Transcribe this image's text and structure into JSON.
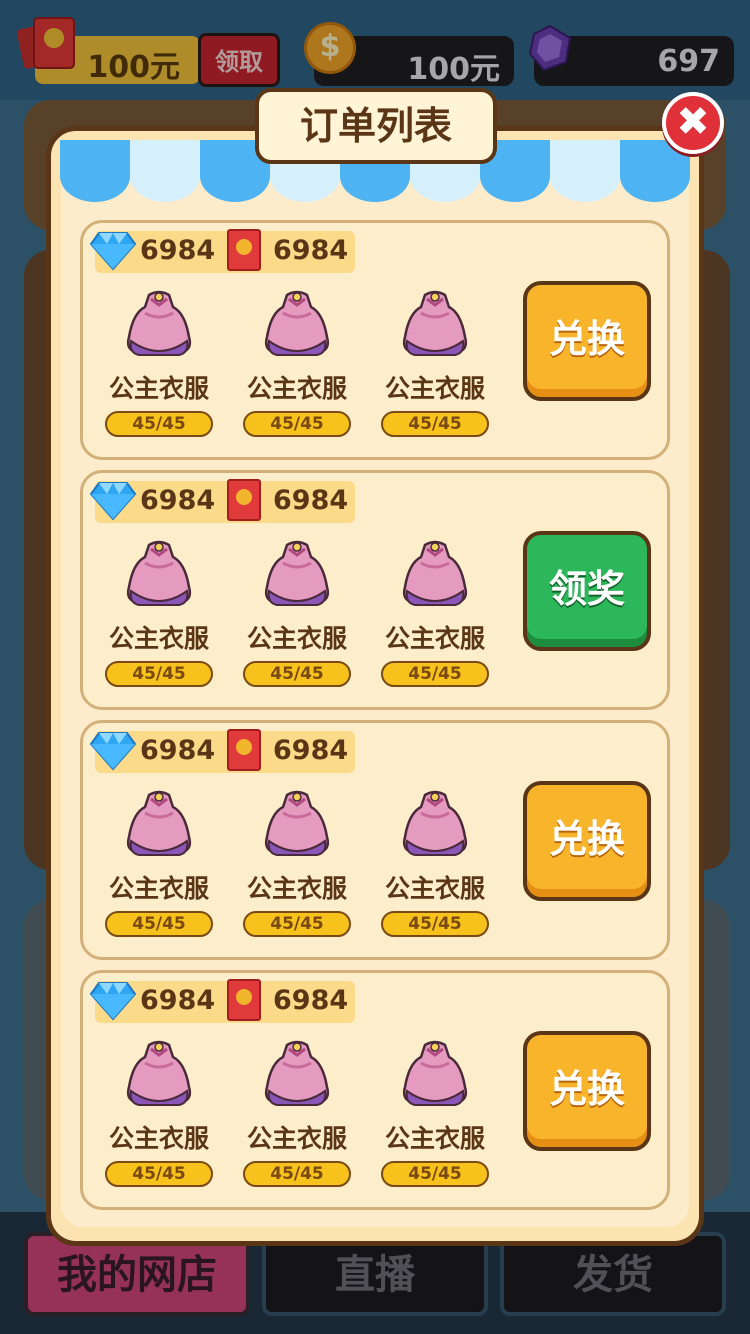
{
  "header": {
    "redpacket_amount": "100元",
    "claim_label": "领取",
    "coin_amount": "100元",
    "gem_amount": "697"
  },
  "modal": {
    "title": "订单列表",
    "close_symbol": "✖"
  },
  "orders": [
    {
      "diamond_reward": "6984",
      "redpacket_reward": "6984",
      "items": [
        {
          "name": "公主衣服",
          "progress": "45/45"
        },
        {
          "name": "公主衣服",
          "progress": "45/45"
        },
        {
          "name": "公主衣服",
          "progress": "45/45"
        }
      ],
      "action_label": "兑换",
      "action_style": "orange"
    },
    {
      "diamond_reward": "6984",
      "redpacket_reward": "6984",
      "items": [
        {
          "name": "公主衣服",
          "progress": "45/45"
        },
        {
          "name": "公主衣服",
          "progress": "45/45"
        },
        {
          "name": "公主衣服",
          "progress": "45/45"
        }
      ],
      "action_label": "领奖",
      "action_style": "green"
    },
    {
      "diamond_reward": "6984",
      "redpacket_reward": "6984",
      "items": [
        {
          "name": "公主衣服",
          "progress": "45/45"
        },
        {
          "name": "公主衣服",
          "progress": "45/45"
        },
        {
          "name": "公主衣服",
          "progress": "45/45"
        }
      ],
      "action_label": "兑换",
      "action_style": "orange"
    },
    {
      "diamond_reward": "6984",
      "redpacket_reward": "6984",
      "items": [
        {
          "name": "公主衣服",
          "progress": "45/45"
        },
        {
          "name": "公主衣服",
          "progress": "45/45"
        },
        {
          "name": "公主衣服",
          "progress": "45/45"
        }
      ],
      "action_label": "兑换",
      "action_style": "orange"
    }
  ],
  "nav": {
    "shop_label": "我的网店",
    "live_label": "直播",
    "ship_label": "发货"
  },
  "colors": {
    "accent_orange": "#f8b42a",
    "accent_green": "#2cb85a",
    "close_red": "#e0303a"
  }
}
